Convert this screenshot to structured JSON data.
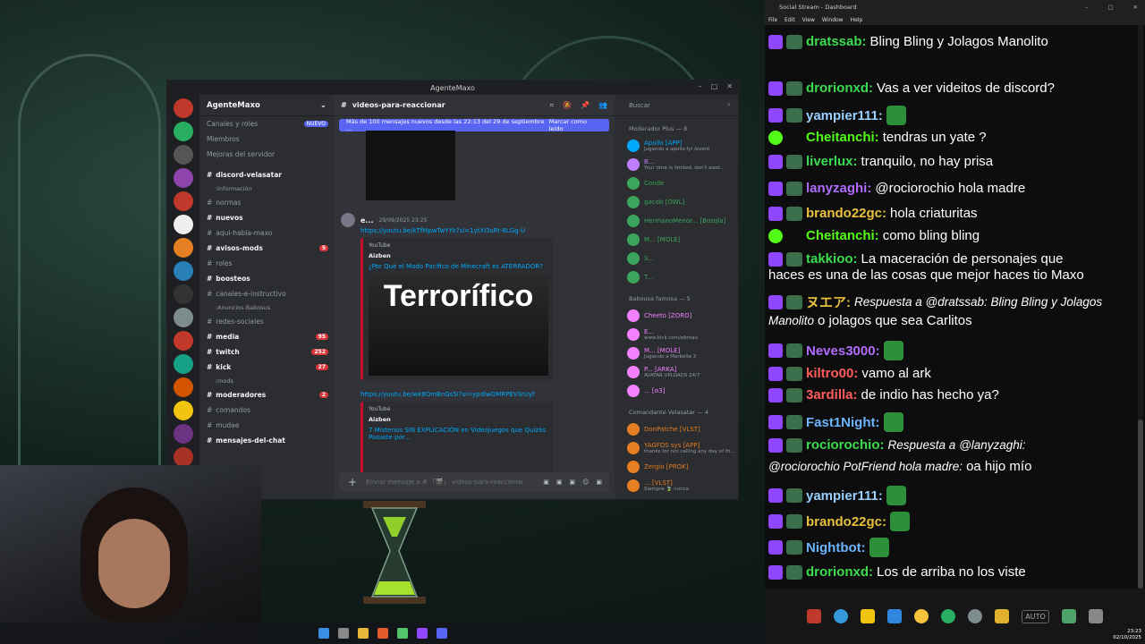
{
  "discord": {
    "window_title": "AgenteMaxo",
    "server_name": "AgenteMaxo",
    "top_items": [
      {
        "label": "Canales y roles",
        "badge": "NUEVO"
      },
      {
        "label": "Miembros"
      },
      {
        "label": "Mejoras del servidor"
      }
    ],
    "channels": [
      {
        "label": "discord-velasatar",
        "bold": true
      },
      {
        "label": "normas"
      },
      {
        "label": "nuevos",
        "bold": true
      },
      {
        "label": "aqui-habla-maxo"
      },
      {
        "label": "avisos-mods",
        "bold": true,
        "count": "5"
      },
      {
        "label": "roles"
      },
      {
        "label": "boosteos",
        "bold": true
      },
      {
        "label": "canales-e-instructivo"
      },
      {
        "label": "redes-sociales"
      },
      {
        "label": "media",
        "bold": true,
        "count": "95"
      },
      {
        "label": "twitch",
        "bold": true,
        "count": "252"
      },
      {
        "label": "kick",
        "bold": true,
        "count": "27"
      },
      {
        "label": "moderadores",
        "bold": true,
        "count": "2"
      },
      {
        "label": "comandos"
      },
      {
        "label": "mudae"
      },
      {
        "label": "mensajes-del-chat",
        "bold": true
      }
    ],
    "categories": [
      "información",
      "Anuncios Babosus",
      "mods"
    ],
    "channel_header": "videos-para-reaccionar",
    "banner": {
      "text": "Más de 100 mensajes nuevos desde las 22:13 del 29 de septiembre ...",
      "action": "Marcar como leído"
    },
    "message": {
      "author": "e...",
      "time": "29/09/2025 23:25",
      "link1": "https://youtu.be/kTfMpwTwYYk?si=1ytXl3sRt-8LGg-U",
      "embed1": {
        "source": "YouTube",
        "author": "Aizben",
        "title": "¿Por Qué el Modo Pacífico de Minecraft es ATERRADOR?",
        "thumb_text": "Terrorífico"
      },
      "link2": "https://youtu.be/wk8OmBnGs5I?si=ypdlwOMRPEVSrUyf",
      "embed2": {
        "source": "YouTube",
        "author": "Aizben",
        "title": "7 Misterios SIN EXPLICACIÓN en Videojuegos que Quizás Pasaste por..."
      }
    },
    "input_placeholder": "Enviar mensaje a # 「🎬」 videos-para-reaccionar",
    "search_placeholder": "Buscar",
    "member_groups": [
      {
        "title": "Moderador Plus — 8",
        "members": [
          {
            "name": "Apollo",
            "tag": "APP",
            "sub": "Jugando a apollo.fyi /event",
            "color": "#00a8fc"
          },
          {
            "name": "B...",
            "sub": "Your time is limited, don't wast...",
            "color": "#c27cff"
          },
          {
            "name": "Conde",
            "color": "#3ba55d"
          },
          {
            "name": "gacob",
            "tag": "OWL",
            "color": "#3ba55d"
          },
          {
            "name": "HermanoMenor...",
            "tag": "Bozqla",
            "color": "#3ba55d"
          },
          {
            "name": "M...",
            "tag": "MOLE",
            "color": "#3ba55d"
          },
          {
            "name": "S...",
            "color": "#3ba55d"
          },
          {
            "name": "T...",
            "color": "#3ba55d"
          }
        ]
      },
      {
        "title": "Babousa famosa — 5",
        "members": [
          {
            "name": "Cheeto",
            "tag": "ZORO",
            "color": "#f47fff"
          },
          {
            "name": "E...",
            "sub": "www.kick.com/ebmao",
            "color": "#f47fff"
          },
          {
            "name": "M...",
            "tag": "MOLE",
            "sub": "Jugando a Marbella 3",
            "color": "#f47fff"
          },
          {
            "name": "P...",
            "tag": "ARKA",
            "sub": "AVATAR UPLOADS 24/7",
            "color": "#f47fff"
          },
          {
            "name": "...",
            "tag": "ɞ3",
            "color": "#f47fff"
          }
        ]
      },
      {
        "title": "Comandante Velasatar — 4",
        "members": [
          {
            "name": "DonPatche",
            "tag": "VLST",
            "color": "#e67e22"
          },
          {
            "name": "YAGFDS sys",
            "tag": "APP",
            "sub": "thanks for not calling any day of th...",
            "color": "#e67e22"
          },
          {
            "name": "Zergio",
            "tag": "PROK",
            "color": "#e67e22"
          },
          {
            "name": "...",
            "tag": "VLST",
            "sub": "Siempre 🍃 nunca",
            "color": "#e67e22"
          }
        ]
      }
    ]
  },
  "social_stream": {
    "window_title": "Social Stream - Dashboard",
    "menu": [
      "File",
      "Edit",
      "View",
      "Window",
      "Help"
    ],
    "messages": [
      {
        "platform": "twitch",
        "user": "dratssab",
        "color": "#3cdc50",
        "text": "Bling Bling y Jolagos Manolito"
      },
      {
        "platform": "twitch",
        "user": "drorionxd",
        "color": "#3cdc50",
        "text": "Vas a ver videitos de discord?"
      },
      {
        "platform": "twitch",
        "user": "yampier111",
        "color": "#9ad0ff",
        "text": ""
      },
      {
        "platform": "kick",
        "user": "Cheitanchi",
        "color": "#53fc18",
        "text": "tendras un yate ?"
      },
      {
        "platform": "twitch",
        "user": "liverlux",
        "color": "#3cdc50",
        "text": "tranquilo, no hay prisa"
      },
      {
        "platform": "twitch",
        "user": "lanyzaghi",
        "color": "#b06cff",
        "text": "@rociorochio  hola madre"
      },
      {
        "platform": "twitch",
        "user": "brando22gc",
        "color": "#e8c03c",
        "text": "hola criaturitas"
      },
      {
        "platform": "kick",
        "user": "Cheitanchi",
        "color": "#53fc18",
        "text": "como bling bling"
      },
      {
        "platform": "twitch",
        "user": "takkioo",
        "color": "#3cdc50",
        "text": "La maceración de personajes que"
      },
      {
        "platform": "",
        "user": "",
        "color": "#fff",
        "text": "haces es una de las cosas que mejor haces tio Maxo"
      },
      {
        "platform": "twitch",
        "user": "ヌエア",
        "color": "#e8c03c",
        "reply": "Respuesta a @dratssab: Bling Bling y Jolagos",
        "text": ""
      },
      {
        "platform": "",
        "user": "",
        "color": "#fff",
        "reply": "Manolito",
        "text": "o jolagos que sea Carlitos"
      },
      {
        "platform": "twitch",
        "user": "Neves3000",
        "color": "#b06cff",
        "text": ""
      },
      {
        "platform": "twitch",
        "user": "kiltro00",
        "color": "#ff5c5c",
        "text": "vamo al ark"
      },
      {
        "platform": "twitch",
        "user": "3ardilla",
        "color": "#ff5c5c",
        "text": "de indio has hecho ya?"
      },
      {
        "platform": "twitch",
        "user": "Fast1Night",
        "color": "#6cb4ff",
        "text": ""
      },
      {
        "platform": "twitch",
        "user": "rociorochio",
        "color": "#3cdc50",
        "reply": "Respuesta a @lanyzaghi:",
        "text": ""
      },
      {
        "platform": "",
        "user": "",
        "color": "#fff",
        "reply": "@rociorochio PotFriend hola madre:",
        "text": "oa hijo mío"
      },
      {
        "platform": "twitch",
        "user": "yampier111",
        "color": "#9ad0ff",
        "text": ""
      },
      {
        "platform": "twitch",
        "user": "brando22gc",
        "color": "#e8c03c",
        "text": ""
      },
      {
        "platform": "twitch",
        "user": "Nightbot",
        "color": "#6cb4ff",
        "text": ""
      },
      {
        "platform": "twitch",
        "user": "drorionxd",
        "color": "#3cdc50",
        "text": "Los de arriba no los viste"
      }
    ],
    "toolbar": [
      "pause-icon",
      "chat-bubble-icon",
      "bell-icon",
      "filter-icon",
      "smiley-icon",
      "recycle-icon",
      "star-icon",
      "broom-icon",
      "auto-icon",
      "mute-icon",
      "collapse-icon"
    ],
    "auto_label": "AUTO"
  },
  "system": {
    "lang": "ESP",
    "time": "23:23",
    "date": "02/10/2025"
  }
}
